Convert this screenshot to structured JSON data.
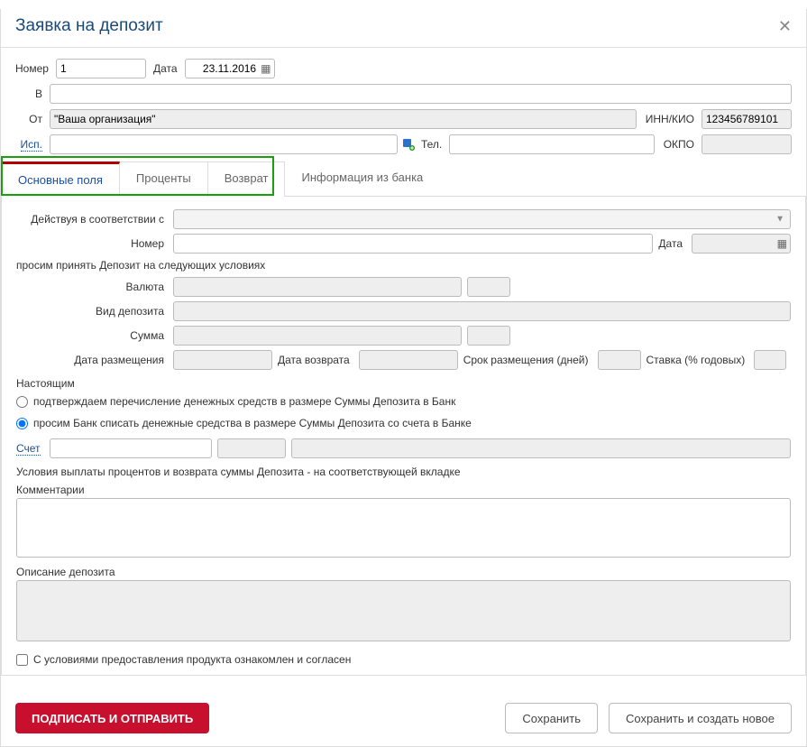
{
  "header": {
    "title": "Заявка на депозит"
  },
  "top": {
    "number_label": "Номер",
    "number_value": "1",
    "date_label": "Дата",
    "date_value": "23.11.2016",
    "to_label": "В",
    "to_value": "",
    "from_label": "От",
    "from_value": "\"Ваша организация\"",
    "inn_label": "ИНН/КИО",
    "inn_value": "123456789101",
    "isp_label": "Исп.",
    "isp_value": "",
    "tel_label": "Тел.",
    "tel_value": "",
    "okpo_label": "ОКПО",
    "okpo_value": ""
  },
  "tabs": {
    "main": "Основные поля",
    "interest": "Проценты",
    "return": "Возврат",
    "bank_info": "Информация из банка"
  },
  "form": {
    "act_label": "Действуя в соответствии с",
    "doc_number_label": "Номер",
    "doc_number_value": "",
    "doc_date_label": "Дата",
    "doc_date_value": "",
    "accept_text": "просим принять Депозит на следующих условиях",
    "currency_label": "Валюта",
    "deposit_type_label": "Вид депозита",
    "sum_label": "Сумма",
    "place_date_label": "Дата размещения",
    "return_date_label": "Дата возврата",
    "term_label": "Срок размещения (дней)",
    "rate_label": "Ставка (% годовых)",
    "hereby_label": "Настоящим",
    "radio1_label": "подтверждаем перечисление денежных средств в размере Суммы Депозита в Банк",
    "radio2_label": "просим Банк списать денежные средства в размере Суммы Депозита со счета в Банке",
    "account_label": "Счет",
    "conditions_note": "Условия выплаты процентов и возврата суммы Депозита  - на соответствующей вкладке",
    "comments_label": "Комментарии",
    "description_label": "Описание депозита",
    "agree_label": "С условиями предоставления продукта ознакомлен и согласен"
  },
  "footer": {
    "sign_send": "ПОДПИСАТЬ И ОТПРАВИТЬ",
    "save": "Сохранить",
    "save_new": "Сохранить и создать новое"
  }
}
